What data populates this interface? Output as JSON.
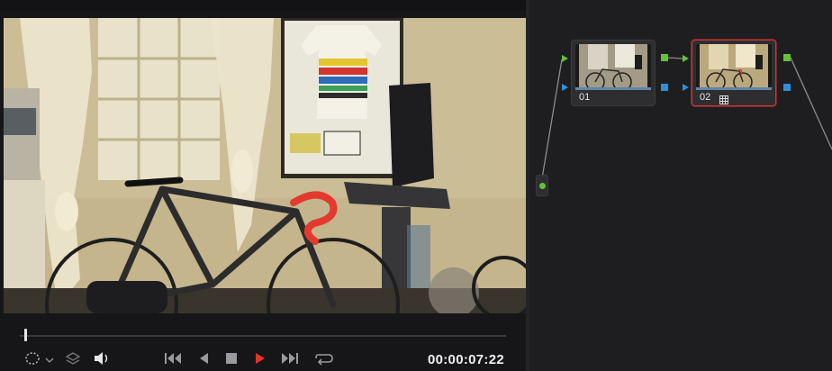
{
  "viewer": {
    "timecode": "00:00:07:22",
    "playhead_fraction": 0.01
  },
  "transport": {
    "buttons": [
      {
        "name": "jump-to-start-button",
        "icon": "skip-back-icon"
      },
      {
        "name": "reverse-play-button",
        "icon": "reverse-play-icon"
      },
      {
        "name": "stop-button",
        "icon": "stop-icon"
      },
      {
        "name": "play-button",
        "icon": "play-icon",
        "color": "#e5322b"
      },
      {
        "name": "jump-to-end-button",
        "icon": "skip-forward-icon"
      },
      {
        "name": "loop-button",
        "icon": "loop-icon"
      }
    ],
    "left_tools": [
      "viewer-mode-icon",
      "layers-icon",
      "volume-icon"
    ]
  },
  "nodes": [
    {
      "id": "node-01",
      "label": "01",
      "selected": false
    },
    {
      "id": "node-02",
      "label": "02",
      "selected": true
    }
  ],
  "colors": {
    "accent_selected": "#c7393a",
    "rgb_port": "#63c23a",
    "alpha_port": "#2f8fd8",
    "play": "#e5322b"
  }
}
